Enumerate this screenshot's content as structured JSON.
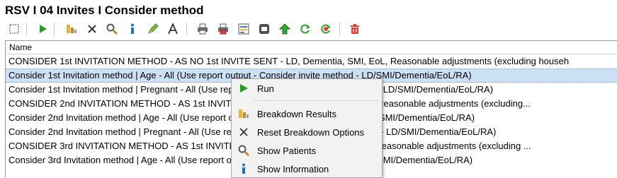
{
  "window": {
    "title": "RSV I 04 Invites I Consider method"
  },
  "toolbar": {
    "icons": [
      "select-icon",
      "run-icon",
      "breakdown-icon",
      "reset-icon",
      "search-icon",
      "info-icon",
      "edit-icon",
      "font-icon",
      "print-icon",
      "print-red-icon",
      "report-icon",
      "export-icon",
      "move-up-icon",
      "refresh-icon",
      "refresh-red-icon",
      "delete-icon"
    ]
  },
  "grid": {
    "header": "Name",
    "rows": [
      "CONSIDER 1st INVITATION METHOD -  AS NO 1st INVITE SENT - LD, Dementia, SMI, EoL, Reasonable adjustments (excluding househ",
      "Consider 1st Invitation method | Age - All (Use report output - Consider invite method - LD/SMI/Dementia/EoL/RA)",
      "Consider 1st Invitation method | Pregnant - All (Use report output - Consider invite method - LD/SMI/Dementia/EoL/RA)",
      "CONSIDER 2nd INVITATION METHOD -  AS 1st INVITE SENT - LD, Dementia, SMI, EoL, Reasonable adjustments (excluding...",
      "Consider 2nd Invitation method | Age - All (Use report output - Consider invite method - LD/SMI/Dementia/EoL/RA)",
      "Consider 2nd Invitation method | Pregnant - All (Use report output - Consider invite method - LD/SMI/Dementia/EoL/RA)",
      "CONSIDER 3rd INVITATION METHOD -  AS 1st INVITE SENT - LD, Dementia, SMI, EoL, Reasonable adjustments (excluding ...",
      "Consider 3rd Invitation method | Age - All (Use report output - Consider invite method - LD/SMI/Dementia/EoL/RA)"
    ],
    "selected_index": 1
  },
  "context_menu": {
    "run": "Run",
    "breakdown": "Breakdown Results",
    "reset": "Reset Breakdown Options",
    "patients": "Show Patients",
    "information": "Show Information"
  },
  "colors": {
    "selection": "#cce0f6",
    "run_green": "#22a020",
    "info_blue": "#1f6fc6",
    "delete_red": "#e03c31"
  }
}
